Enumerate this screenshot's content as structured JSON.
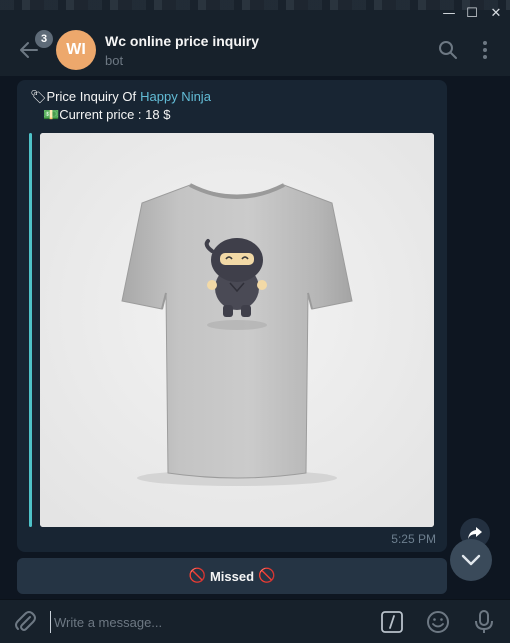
{
  "window": {
    "minimize_glyph": "—",
    "maximize_glyph": "☐",
    "close_glyph": "✕"
  },
  "header": {
    "unread_count": "3",
    "avatar_initials": "WI",
    "avatar_color": "#eda86c",
    "title": "Wc online price inquiry",
    "status": "bot",
    "icons": [
      "back-arrow-icon",
      "search-icon",
      "more-vertical-icon"
    ]
  },
  "message": {
    "line1_prefix": "Price Inquiry Of",
    "line1_link": "Happy Ninja",
    "line2": "Current price : 18 $",
    "line1_emoji": "🏷",
    "line2_emoji": "💵",
    "time": "5:25 PM",
    "accent_color": "#4fc3c9",
    "link_color": "#62bcd6"
  },
  "missed": {
    "label": "Missed",
    "emoji": "🚫"
  },
  "composer": {
    "placeholder": "Write a message...",
    "icons": [
      "attach-icon",
      "bot-commands-icon",
      "emoji-icon",
      "microphone-icon"
    ]
  }
}
